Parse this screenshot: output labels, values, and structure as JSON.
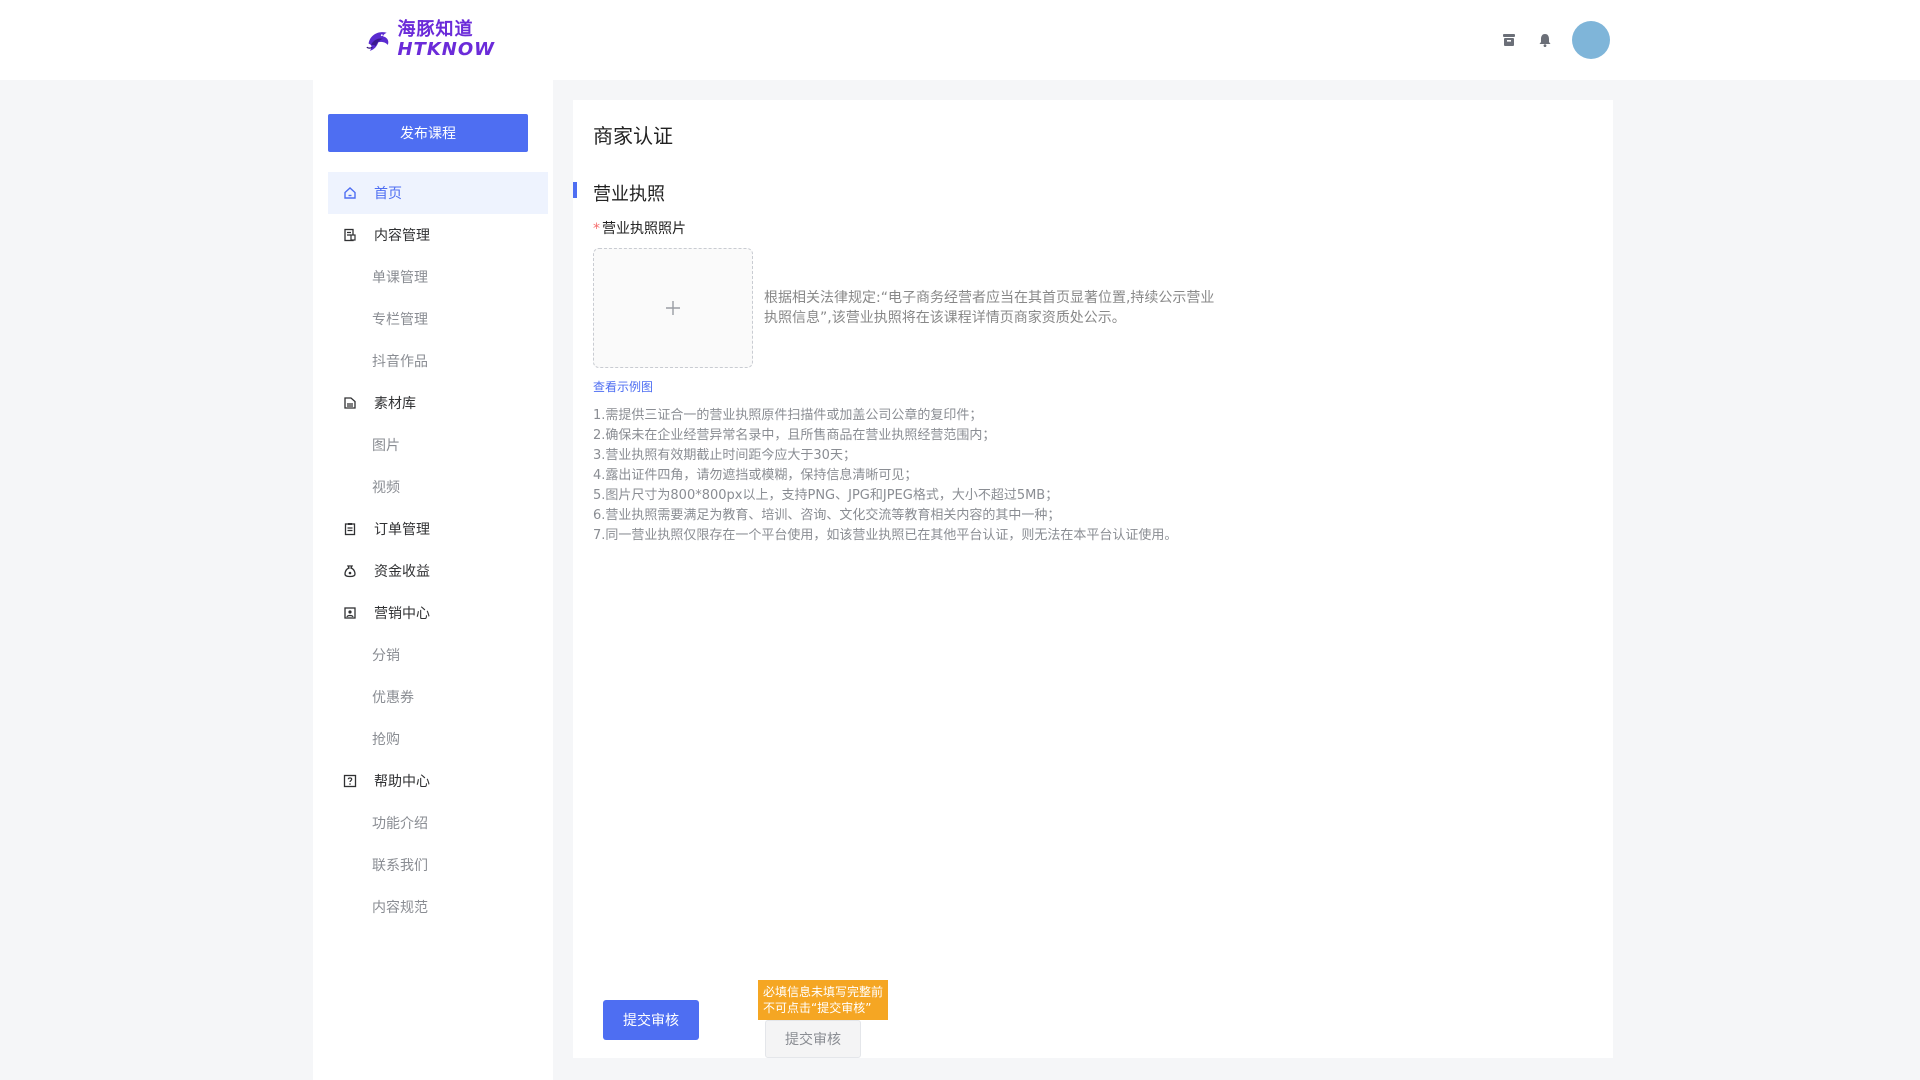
{
  "header": {
    "logo_cn": "海豚知道",
    "logo_en": "HTKNOW",
    "icons": [
      "archive-icon",
      "bell-icon"
    ]
  },
  "sidebar": {
    "publish_button": "发布课程",
    "items": [
      {
        "label": "首页",
        "icon": "home-icon",
        "active": true
      },
      {
        "label": "内容管理",
        "icon": "content-icon"
      },
      {
        "label": "单课管理",
        "sub": true
      },
      {
        "label": "专栏管理",
        "sub": true
      },
      {
        "label": "抖音作品",
        "sub": true
      },
      {
        "label": "素材库",
        "icon": "folder-icon"
      },
      {
        "label": "图片",
        "sub": true
      },
      {
        "label": "视频",
        "sub": true
      },
      {
        "label": "订单管理",
        "icon": "clipboard-icon"
      },
      {
        "label": "资金收益",
        "icon": "money-bag-icon"
      },
      {
        "label": "营销中心",
        "icon": "marketing-icon"
      },
      {
        "label": "分销",
        "sub": true
      },
      {
        "label": "优惠券",
        "sub": true
      },
      {
        "label": "抢购",
        "sub": true
      },
      {
        "label": "帮助中心",
        "icon": "help-icon"
      },
      {
        "label": "功能介绍",
        "sub": true
      },
      {
        "label": "联系我们",
        "sub": true
      },
      {
        "label": "内容规范",
        "sub": true
      }
    ]
  },
  "main": {
    "title": "商家认证",
    "section_title": "营业执照",
    "field_label": "营业执照照片",
    "upload_note": "根据相关法律规定:“电子商务经营者应当在其首页显著位置,持续公示营业执照信息”,该营业执照将在该课程详情页商家资质处公示。",
    "example_link": "查看示例图",
    "requirements": [
      "1.需提供三证合一的营业执照原件扫描件或加盖公司公章的复印件；",
      "2.确保未在企业经营异常名录中，且所售商品在营业执照经营范围内；",
      "3.营业执照有效期截止时间距今应大于30天；",
      "4.露出证件四角，请勿遮挡或模糊，保持信息清晰可见；",
      "5.图片尺寸为800*800px以上，支持PNG、JPG和JPEG格式，大小不超过5MB；",
      "6.营业执照需要满足为教育、培训、咨询、文化交流等教育相关内容的其中一种；",
      "7.同一营业执照仅限存在一个平台使用，如该营业执照已在其他平台认证，则无法在本平台认证使用。"
    ],
    "submit_label": "提交审核",
    "submit_disabled_label": "提交审核",
    "tooltip_line1": "必填信息未填写完整前",
    "tooltip_line2": "不可点击“提交审核”"
  },
  "colors": {
    "primary": "#4e6ef2",
    "warning": "#f5a623",
    "logo": "#6b2bd9",
    "avatar": "#7fb5d9"
  }
}
